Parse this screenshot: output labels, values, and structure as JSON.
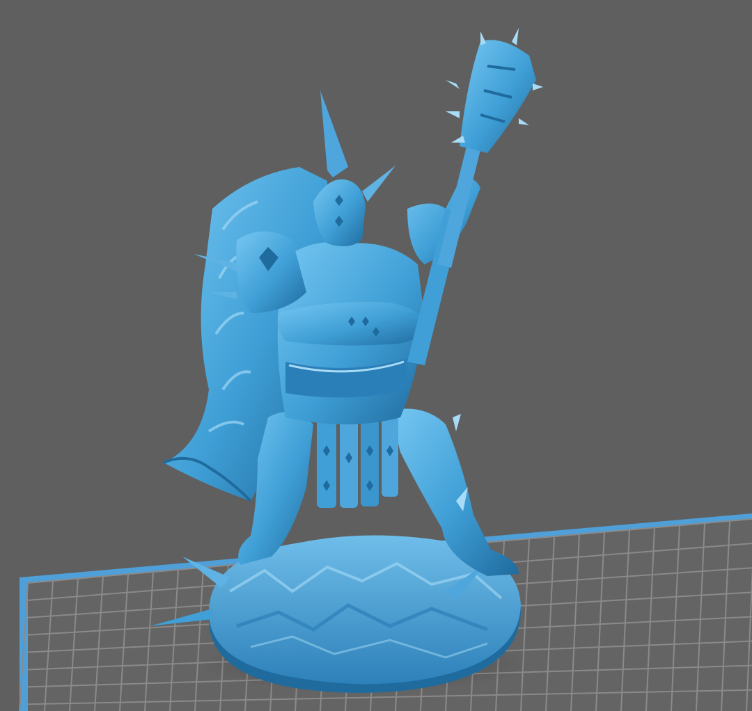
{
  "viewport": {
    "background_color": "#5f5f5f",
    "model_color": "#3f9fd6",
    "model_highlight_color": "#76c7f2",
    "model_shadow_color": "#1f6b9e",
    "grid_line_color": "#8a8a8a",
    "grid_border_color": "#4f9fd8"
  },
  "objects": [
    {
      "name": "build-plate-grid",
      "icon": "build-plate"
    },
    {
      "name": "miniature-model",
      "icon": "3d-model"
    }
  ]
}
